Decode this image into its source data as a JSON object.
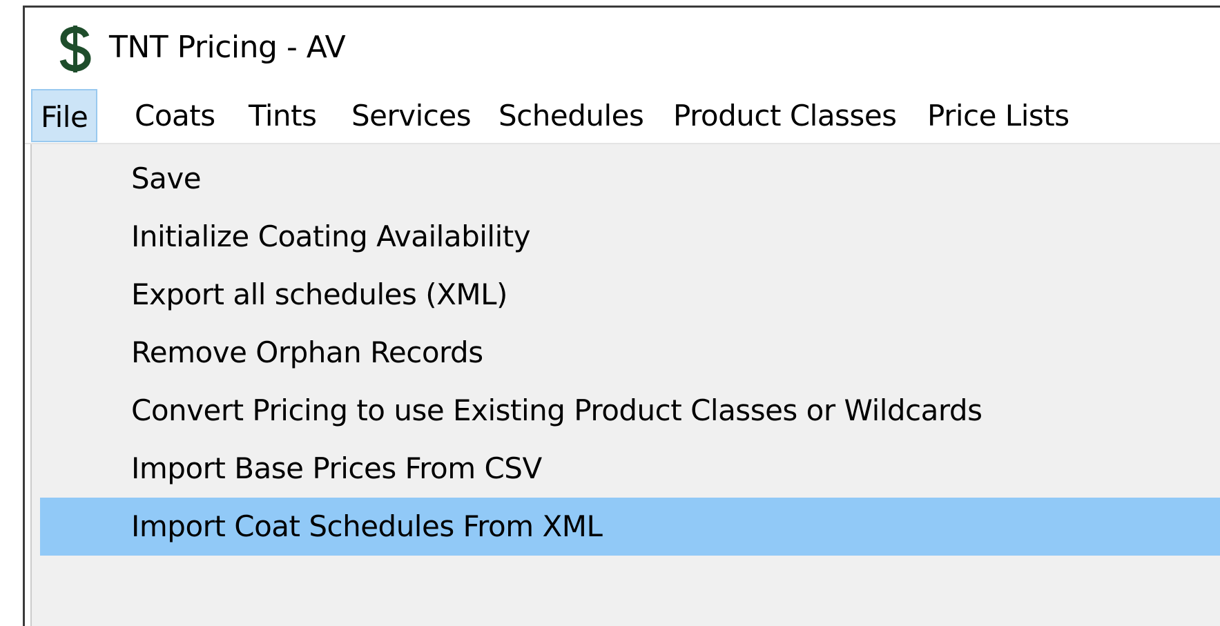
{
  "window": {
    "title": "TNT Pricing - AV",
    "icon": "dollar-sign-icon"
  },
  "menubar": {
    "items": [
      {
        "label": "File",
        "active": true
      },
      {
        "label": "Coats"
      },
      {
        "label": "Tints"
      },
      {
        "label": "Services"
      },
      {
        "label": "Schedules"
      },
      {
        "label": "Product Classes"
      },
      {
        "label": "Price Lists"
      }
    ]
  },
  "file_menu": {
    "items": [
      {
        "label": "Save"
      },
      {
        "label": "Initialize Coating Availability"
      },
      {
        "label": "Export all schedules (XML)"
      },
      {
        "label": "Remove Orphan Records"
      },
      {
        "label": "Convert Pricing to use Existing Product Classes or Wildcards"
      },
      {
        "label": "Import Base Prices From CSV"
      },
      {
        "label": "Import Coat Schedules From XML",
        "highlighted": true
      }
    ]
  },
  "colors": {
    "menu_active_bg": "#cce4f7",
    "menu_active_border": "#99c9ef",
    "dropdown_bg": "#f0f0f0",
    "dropdown_highlight": "#91c9f7",
    "icon_green": "#1e4d2b"
  }
}
